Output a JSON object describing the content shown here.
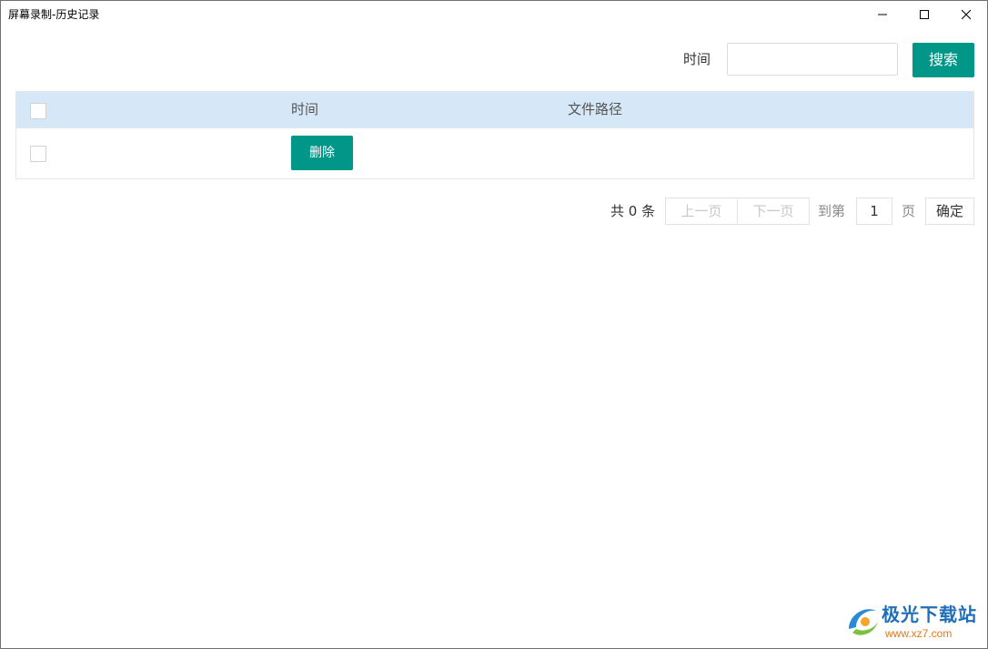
{
  "window": {
    "title": "屏幕录制-历史记录",
    "minimize_icon": "minimize-icon",
    "maximize_icon": "maximize-icon",
    "close_icon": "close-icon"
  },
  "search": {
    "label": "时间",
    "value": "",
    "placeholder": "",
    "button_label": "搜索",
    "button_color": "#009688"
  },
  "table": {
    "header_background": "#d6e8f7",
    "columns": [
      "时间",
      "文件路径"
    ],
    "rows": [
      {
        "checked": false,
        "time": "",
        "path": "",
        "action_label": "删除"
      }
    ]
  },
  "pager": {
    "total_text": "共 0 条",
    "prev_label": "上一页",
    "next_label": "下一页",
    "goto_label": "到第",
    "page_value": "1",
    "page_suffix": "页",
    "confirm_label": "确定"
  },
  "watermark": {
    "name": "极光下载站",
    "url": "www.xz7.com"
  }
}
